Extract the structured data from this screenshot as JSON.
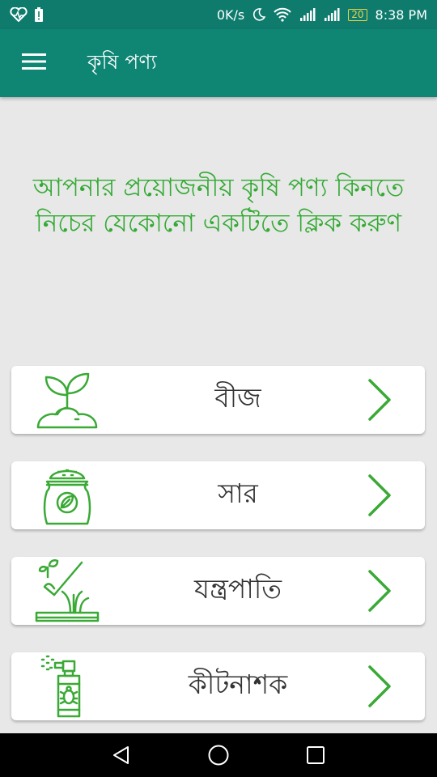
{
  "status_bar": {
    "speed": "0K/s",
    "battery": "20",
    "time": "8:38 PM"
  },
  "app_bar": {
    "title": "কৃষি পণ্য"
  },
  "prompt": {
    "text": "আপনার প্রয়োজনীয় কৃষি পণ্য কিনতে নিচের যেকোনো একটিতে ক্লিক করুণ"
  },
  "categories": [
    {
      "label": "বীজ",
      "icon": "seedling-icon"
    },
    {
      "label": "সার",
      "icon": "fertilizer-sack-icon"
    },
    {
      "label": "যন্ত্রপাতি",
      "icon": "hoe-tool-icon"
    },
    {
      "label": "কীটনাশক",
      "icon": "pesticide-spray-icon"
    }
  ],
  "colors": {
    "status_bar": "#0e7b6d",
    "app_bar": "#0f8574",
    "accent_green": "#33aa33",
    "background": "#e8e8e8"
  }
}
